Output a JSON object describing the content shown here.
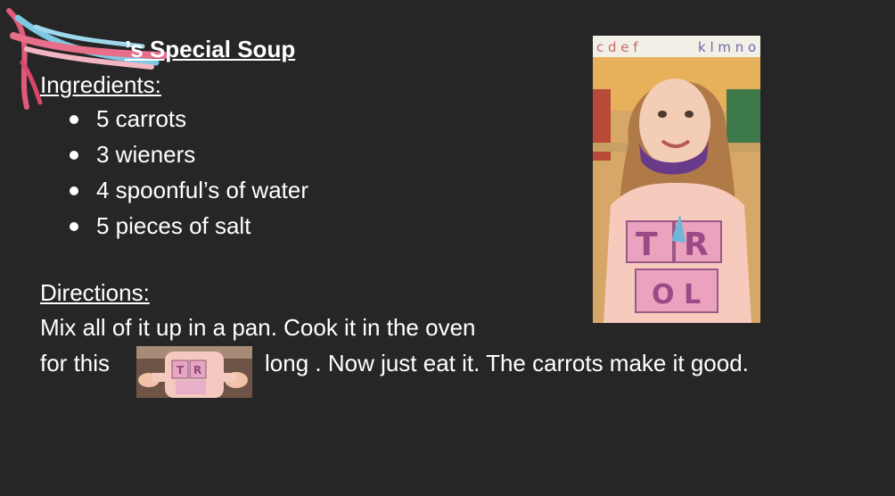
{
  "recipe": {
    "title": "’s Special Soup",
    "ingredients_heading": "Ingredients:",
    "ingredients": [
      "5 carrots",
      "3 wieners",
      "4 spoonful’s of water",
      "5 pieces of salt"
    ],
    "directions_heading": "Directions:",
    "directions_line1": "Mix all of it up in a pan. Cook it in the oven",
    "directions_line2a": "for this",
    "directions_line2b": "long . Now just eat it. The carrots make it good."
  },
  "photo_text": {
    "shirt_letters": "TROLLS",
    "wall_letters": "cdef ijklmno"
  }
}
